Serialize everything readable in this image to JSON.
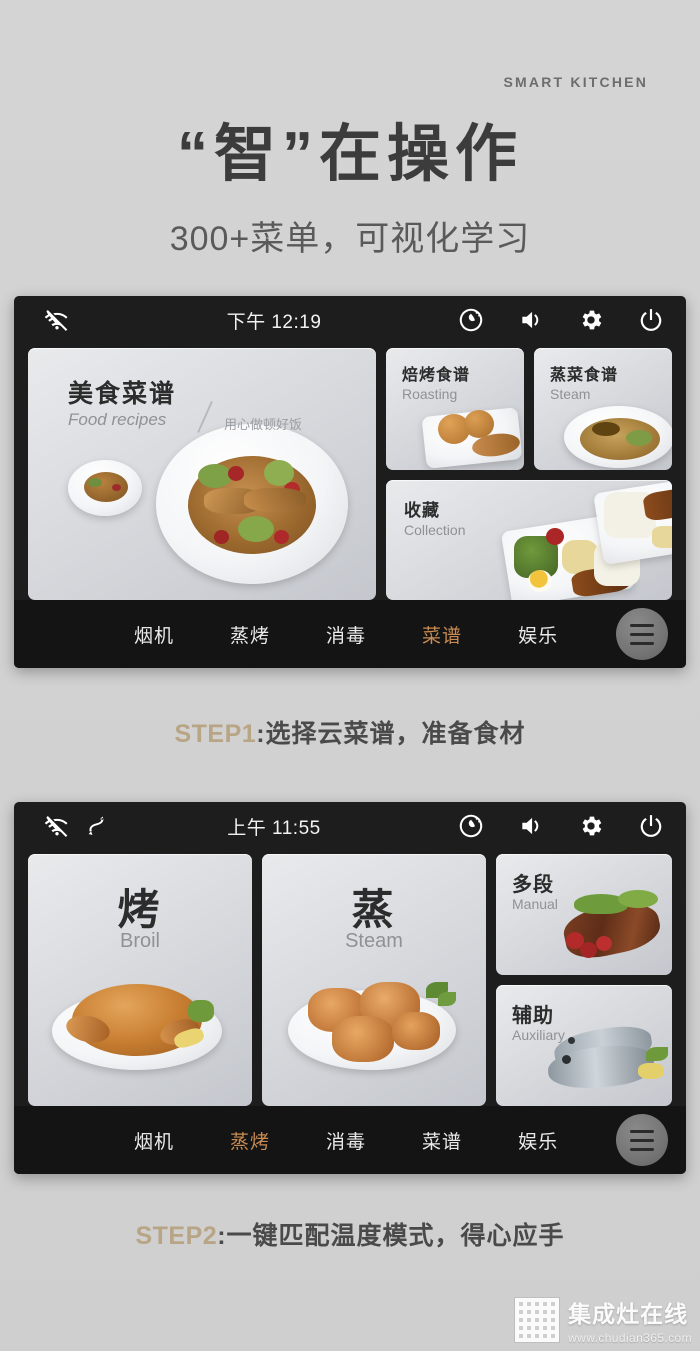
{
  "header": {
    "eyebrow": "SMART  KITCHEN",
    "headline": "“智”在操作",
    "subhead": "300+菜单，可视化学习"
  },
  "screen1": {
    "statusbar": {
      "time": "下午 12:19",
      "icons": [
        "wifi-off-icon",
        "humidity-icon",
        "volume-icon",
        "settings-icon",
        "power-icon"
      ]
    },
    "cards": {
      "main": {
        "title": "美食菜谱",
        "subtitle": "Food recipes",
        "tagline": "用心做顿好饭"
      },
      "roasting": {
        "title": "焙烤食谱",
        "subtitle": "Roasting"
      },
      "steam": {
        "title": "蒸菜食谱",
        "subtitle": "Steam"
      },
      "collection": {
        "title": "收藏",
        "subtitle": "Collection"
      }
    },
    "nav": {
      "items": [
        {
          "label": "烟机",
          "active": false
        },
        {
          "label": "蒸烤",
          "active": false
        },
        {
          "label": "消毒",
          "active": false
        },
        {
          "label": "菜谱",
          "active": true
        },
        {
          "label": "娱乐",
          "active": false
        }
      ],
      "menu_icon": "hamburger-menu-icon"
    }
  },
  "step1": {
    "num": "STEP1",
    "text": ":选择云菜谱，准备食材"
  },
  "screen2": {
    "statusbar": {
      "time": "上午 11:55",
      "icons": [
        "wifi-off-icon",
        "sync-icon",
        "humidity-icon",
        "volume-icon",
        "settings-icon",
        "power-icon"
      ]
    },
    "cards": {
      "broil": {
        "title": "烤",
        "subtitle": "Broil"
      },
      "steam": {
        "title": "蒸",
        "subtitle": "Steam"
      },
      "manual": {
        "title": "多段",
        "subtitle": "Manual"
      },
      "auxiliary": {
        "title": "辅助",
        "subtitle": "Auxiliary"
      }
    },
    "nav": {
      "items": [
        {
          "label": "烟机",
          "active": false
        },
        {
          "label": "蒸烤",
          "active": true
        },
        {
          "label": "消毒",
          "active": false
        },
        {
          "label": "菜谱",
          "active": false
        },
        {
          "label": "娱乐",
          "active": false
        }
      ],
      "menu_icon": "hamburger-menu-icon"
    }
  },
  "step2": {
    "num": "STEP2",
    "text": ":一键匹配温度模式，得心应手"
  },
  "watermark": {
    "name": "集成灶在线",
    "url": "www.chudian365.com"
  },
  "colors": {
    "background": "#d2d2d2",
    "panel": "#1d1d1d",
    "nav_active": "#c98b52",
    "step_number": "#b8a585",
    "headline": "#3c3c3c"
  }
}
